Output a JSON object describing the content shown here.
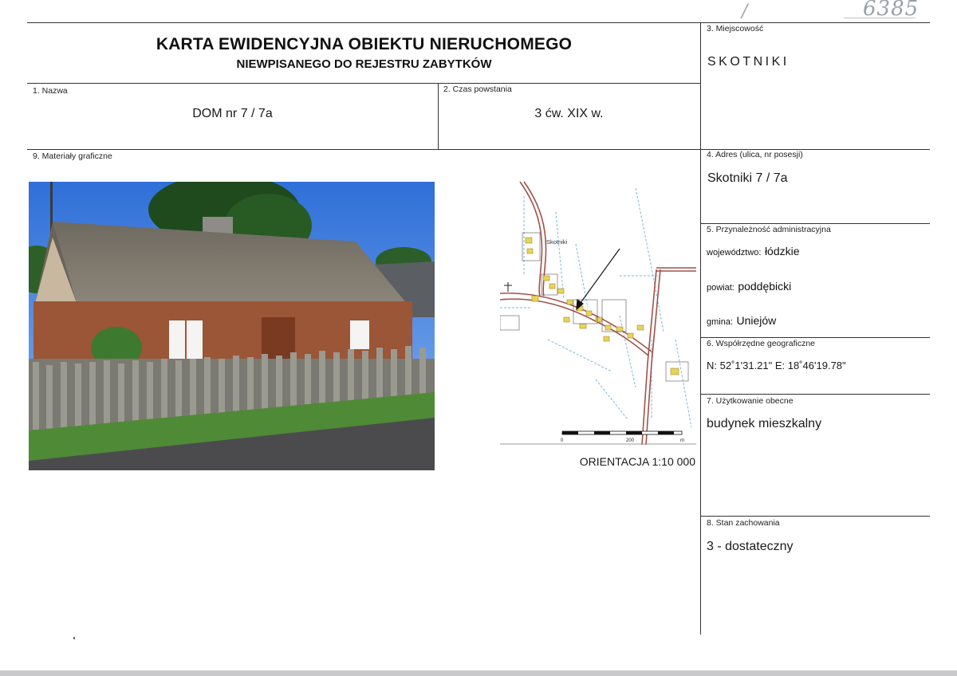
{
  "header": {
    "title_line1": "KARTA EWIDENCYJNA OBIEKTU NIERUCHOMEGO",
    "title_line2": "NIEWPISANEGO DO REJESTRU ZABYTKÓW",
    "handwritten_number": "6385",
    "handwritten_mark": "/"
  },
  "fields": {
    "nazwa": {
      "label": "1. Nazwa",
      "value": "DOM nr 7 / 7a"
    },
    "czas": {
      "label": "2. Czas powstania",
      "value": "3 ćw. XIX w."
    },
    "miejscowosc": {
      "label": "3. Miejscowość",
      "value": "SKOTNIKI"
    },
    "adres": {
      "label": "4. Adres (ulica, nr posesji)",
      "value": "Skotniki 7 / 7a"
    },
    "przynaleznosc": {
      "label": "5. Przynależność administracyjna",
      "wojewodztwo_label": "województwo:",
      "wojewodztwo": "łódzkie",
      "powiat_label": "powiat:",
      "powiat": "poddębicki",
      "gmina_label": "gmina:",
      "gmina": "Uniejów"
    },
    "wspolrzedne": {
      "label": "6. Współrzędne geograficzne",
      "value": "N: 52˚1'31.21\" E: 18˚46'19.78\""
    },
    "uzytkowanie": {
      "label": "7. Użytkowanie obecne",
      "value": "budynek mieszkalny"
    },
    "stan": {
      "label": "8. Stan zachowania",
      "value": "3 - dostateczny"
    },
    "materialy": {
      "label": "9. Materiały graficzne"
    }
  },
  "map": {
    "place_label": "Skotniki",
    "scale_zero": "0",
    "scale_mid": "200",
    "scale_unit": "m",
    "orientation": "ORIENTACJA 1:10 000"
  },
  "colors": {
    "line": "#333333",
    "road": "#a0524a",
    "map_line": "#7fb7d8",
    "building": "#e8d45a"
  }
}
